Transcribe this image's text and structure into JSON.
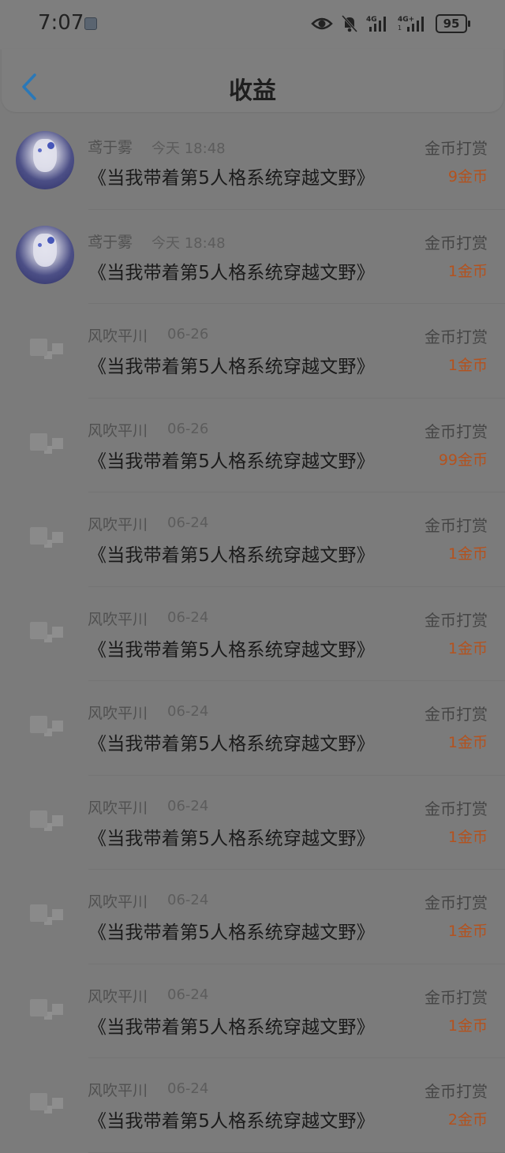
{
  "status_bar": {
    "time": "7:07",
    "battery": "95",
    "icons": [
      "eye-icon",
      "bell-off-icon",
      "signal-4g-icon",
      "signal-4g-plus-icon"
    ]
  },
  "header": {
    "title": "收益",
    "back_icon": "chevron-left-icon"
  },
  "colors": {
    "amount": "#b4521e",
    "back_arrow": "#2a78b8"
  },
  "rewards": [
    {
      "user": "鸢于雾",
      "date": "今天 18:48",
      "book": "《当我带着第5人格系统穿越文野》",
      "type": "金币打赏",
      "amount": "9金币",
      "avatar": "anime"
    },
    {
      "user": "鸢于雾",
      "date": "今天 18:48",
      "book": "《当我带着第5人格系统穿越文野》",
      "type": "金币打赏",
      "amount": "1金币",
      "avatar": "anime"
    },
    {
      "user": "风吹平川",
      "date": "06-26",
      "book": "《当我带着第5人格系统穿越文野》",
      "type": "金币打赏",
      "amount": "1金币",
      "avatar": "faded"
    },
    {
      "user": "风吹平川",
      "date": "06-26",
      "book": "《当我带着第5人格系统穿越文野》",
      "type": "金币打赏",
      "amount": "99金币",
      "avatar": "faded"
    },
    {
      "user": "风吹平川",
      "date": "06-24",
      "book": "《当我带着第5人格系统穿越文野》",
      "type": "金币打赏",
      "amount": "1金币",
      "avatar": "faded"
    },
    {
      "user": "风吹平川",
      "date": "06-24",
      "book": "《当我带着第5人格系统穿越文野》",
      "type": "金币打赏",
      "amount": "1金币",
      "avatar": "faded"
    },
    {
      "user": "风吹平川",
      "date": "06-24",
      "book": "《当我带着第5人格系统穿越文野》",
      "type": "金币打赏",
      "amount": "1金币",
      "avatar": "faded"
    },
    {
      "user": "风吹平川",
      "date": "06-24",
      "book": "《当我带着第5人格系统穿越文野》",
      "type": "金币打赏",
      "amount": "1金币",
      "avatar": "faded"
    },
    {
      "user": "风吹平川",
      "date": "06-24",
      "book": "《当我带着第5人格系统穿越文野》",
      "type": "金币打赏",
      "amount": "1金币",
      "avatar": "faded"
    },
    {
      "user": "风吹平川",
      "date": "06-24",
      "book": "《当我带着第5人格系统穿越文野》",
      "type": "金币打赏",
      "amount": "1金币",
      "avatar": "faded"
    },
    {
      "user": "风吹平川",
      "date": "06-24",
      "book": "《当我带着第5人格系统穿越文野》",
      "type": "金币打赏",
      "amount": "2金币",
      "avatar": "faded"
    }
  ]
}
